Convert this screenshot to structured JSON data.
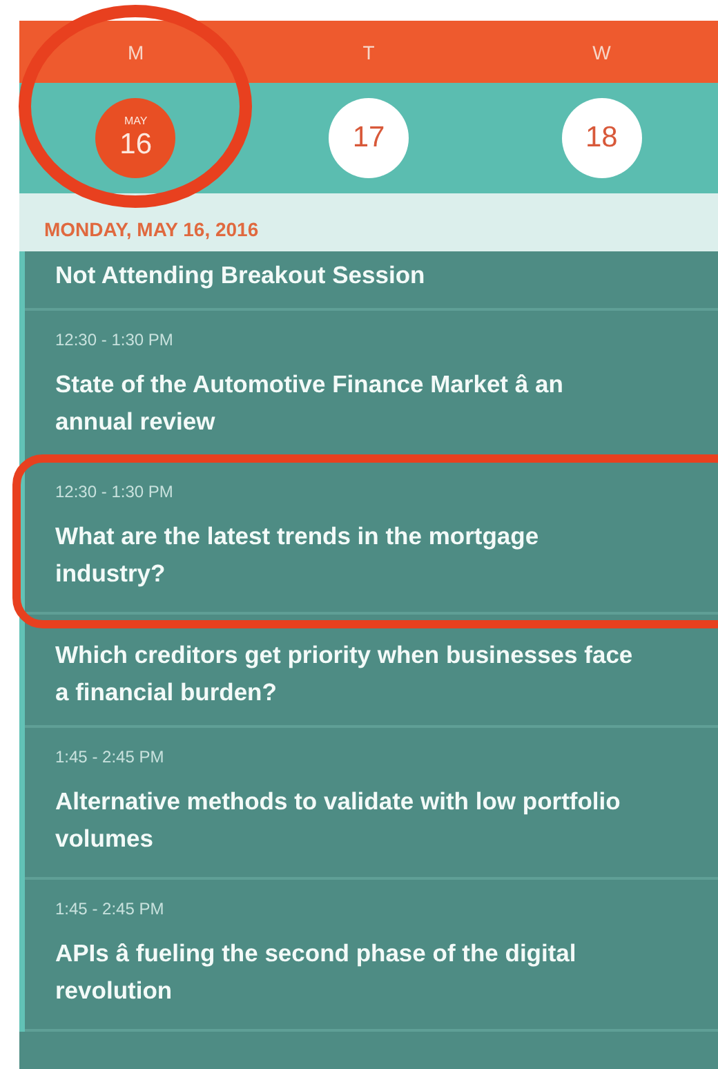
{
  "days": [
    {
      "letter": "M",
      "month": "MAY",
      "number": "16",
      "selected": true
    },
    {
      "letter": "T",
      "number": "17",
      "selected": false
    },
    {
      "letter": "W",
      "number": "18",
      "selected": false
    }
  ],
  "date_header": "MONDAY, MAY 16, 2016",
  "sessions": [
    {
      "title": "Not Attending Breakout Session"
    },
    {
      "time": "12:30 - 1:30 PM",
      "title": "State of the Automotive Finance Market â an annual review"
    },
    {
      "time": "12:30 - 1:30 PM",
      "title": "What are the latest trends in the mortgage industry?",
      "highlighted": true
    },
    {
      "title": "Which creditors get priority when businesses face a financial burden?"
    },
    {
      "time": "1:45 - 2:45 PM",
      "title": "Alternative methods to validate with low portfolio volumes"
    },
    {
      "time": "1:45 - 2:45 PM",
      "title": "APIs â fueling the second phase of the digital revolution"
    }
  ]
}
